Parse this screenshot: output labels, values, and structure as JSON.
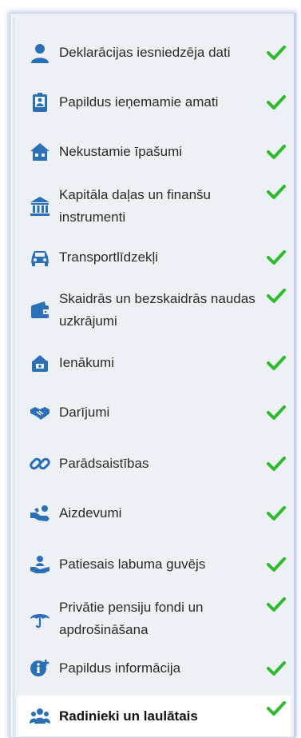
{
  "nav": {
    "items": [
      {
        "label": "Deklarācijas iesniedzēja dati",
        "icon": "person-icon",
        "done": true
      },
      {
        "label": "Papildus ieņemamie amati",
        "icon": "id-badge-icon",
        "done": true
      },
      {
        "label": "Nekustamie īpašumi",
        "icon": "house-icon",
        "done": true
      },
      {
        "label": "Kapitāla daļas un finanšu instrumenti",
        "icon": "bank-icon",
        "done": true
      },
      {
        "label": "Transportlīdzekļi",
        "icon": "car-icon",
        "done": true
      },
      {
        "label": "Skaidrās un bezskaidrās naudas uzkrājumi",
        "icon": "wallet-icon",
        "done": true
      },
      {
        "label": "Ienākumi",
        "icon": "income-icon",
        "done": true
      },
      {
        "label": "Darījumi",
        "icon": "handshake-icon",
        "done": true
      },
      {
        "label": "Parādsaistības",
        "icon": "chain-link-icon",
        "done": true
      },
      {
        "label": "Aizdevumi",
        "icon": "hand-coin-icon",
        "done": true
      },
      {
        "label": "Patiesais labuma guvējs",
        "icon": "hand-person-icon",
        "done": true
      },
      {
        "label": "Privātie pensiju fondi un apdrošināšana",
        "icon": "umbrella-icon",
        "done": true
      },
      {
        "label": "Papildus informācija",
        "icon": "info-plus-icon",
        "done": true
      },
      {
        "label": "Radinieki un laulātais",
        "icon": "people-icon",
        "done": true,
        "active": true
      }
    ]
  },
  "colors": {
    "icon": "#2b6fb6",
    "check": "#2fb92f",
    "panel": "#edf0f5",
    "active": "#ffffff"
  }
}
